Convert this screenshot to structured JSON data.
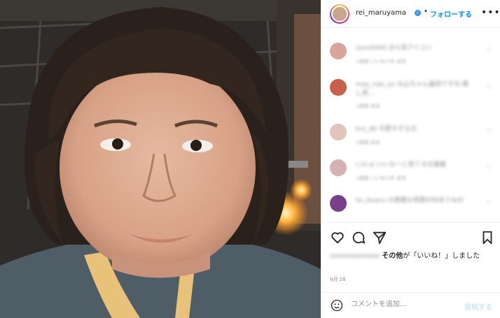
{
  "header": {
    "username": "rei_maruyama",
    "separator": "•",
    "follow_label": "フォローする",
    "more_icon": "more-horizontal-icon"
  },
  "comments": [
    {
      "text": "sunsh000 ほら見アイコン",
      "meta": "1週間   いいね!1件   返信",
      "avatar_color": "#d9a59a"
    },
    {
      "text": "may_nao_yu 丸山ちゃん最高ですね 癒し笑...",
      "meta": "1週間   返信",
      "avatar_color": "#c8604a"
    },
    {
      "text": "kro_db 可愛すぎる😊",
      "meta": "1週間   返信",
      "avatar_color": "#e2c4b8"
    },
    {
      "text": "c.hi.ai いいなーに見てる😊素敵",
      "meta": "1週間   いいね!1件   返信",
      "avatar_color": "#d7b0b2"
    },
    {
      "text": "ko_ikuaru の素敵な笑顔が似合うね😊",
      "meta": "1週間   返信",
      "avatar_color": "#7a3f8a"
    }
  ],
  "likes": {
    "blurred_name": "xxxxxxxxxxxx",
    "others_label": "その他",
    "suffix": "が「いいね！」しました"
  },
  "date": "9月 28",
  "add_comment": {
    "placeholder": "コメントを追加...",
    "post_label": "投稿する"
  }
}
